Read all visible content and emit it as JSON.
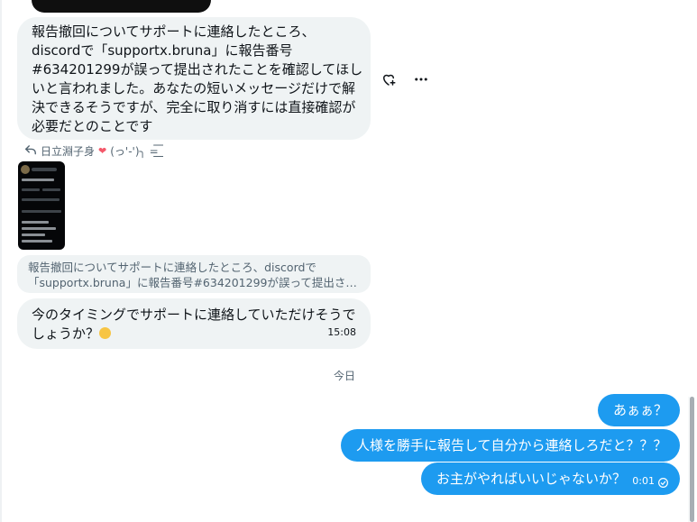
{
  "incoming_1": {
    "lines": [
      "報告撤回についてサポートに連絡したところ、",
      "discordで「supportx.bruna」に報告番号",
      "#634201299が誤って提出されたことを確認してほし",
      "いと言われました。あなたの短いメッセージだけで解",
      "決できるそうですが、完全に取り消すには直接確認が",
      "必要だとのことです"
    ]
  },
  "actions": {
    "react_icon": "heart-plus-icon",
    "more_icon": "more-horizontal-icon"
  },
  "reply": {
    "name": "日立淵子身",
    "suffix": "(っ'-')╮ =͟͟͞͞",
    "icon": "reply-arrow-icon"
  },
  "quote": {
    "lines": [
      "報告撤回についてサポートに連絡したところ、discordで",
      "「supportx.bruna」に報告番号#634201299が誤って提出さ…"
    ]
  },
  "incoming_2": {
    "lines": [
      "今のタイミングでサポートに連絡していただけそうで",
      "しょうか？"
    ],
    "time": "15:08"
  },
  "day_separator": "今日",
  "outgoing": [
    {
      "text": "あぁぁ？"
    },
    {
      "text": "人様を勝手に報告して自分から連絡しろだと？？？"
    },
    {
      "text": "お主がやればいいじゃないか？",
      "time": "0:01",
      "status_icon": "read-check-icon"
    }
  ],
  "colors": {
    "accent": "#1d9bf0",
    "incoming_bg": "#eff3f4",
    "text": "#0f1419",
    "muted": "#536471"
  }
}
